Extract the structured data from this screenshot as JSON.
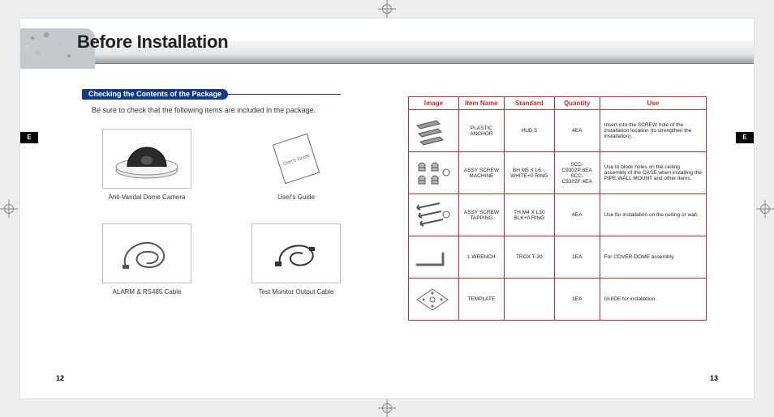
{
  "sidetab": "E",
  "left": {
    "title": "Before Installation",
    "section": "Checking the Contents of the Package",
    "intro": "Be sure to check that the following items are included in the package.",
    "items": [
      {
        "caption": "Anti-Vandal Dome Camera"
      },
      {
        "caption": "User's Guide",
        "sheet_label": "User's Guide"
      },
      {
        "caption": "ALARM & RS485 Cable"
      },
      {
        "caption": "Test Monitor Output Cable"
      }
    ],
    "pagenum": "12"
  },
  "right": {
    "table": {
      "headers": [
        "Image",
        "Item Name",
        "Standard",
        "Quantity",
        "Use"
      ],
      "rows": [
        {
          "name": "PLASTIC ANCHOR",
          "standard": "HUD 5",
          "qty": "4EA",
          "use": "Insert into the SCREW hole of the installation location (to strengthen the installation)."
        },
        {
          "name": "ASSY SCREW MACHINE",
          "standard": "BH M5 X L6.-, WHITE+0 RING",
          "qty": "SCC-C9302P:8EA SCC-C9302F:4EA",
          "use": "Use to block holes on the ceiling assembly of the CASE when installing the PIPE,WALL MOUNT and other items."
        },
        {
          "name": "ASSY SCREW TAPPING",
          "standard": "TH M4 X L30 BLK+0 RING",
          "qty": "4EA",
          "use": "Use for installation on the ceiling or wall."
        },
        {
          "name": "L WRENCH",
          "standard": "TROX T-20",
          "qty": "1EA",
          "use": "For COVER-DOME assembly."
        },
        {
          "name": "TEMPLATE",
          "standard": "",
          "qty": "1EA",
          "use": "GUIDE for installation."
        }
      ]
    },
    "pagenum": "13"
  }
}
